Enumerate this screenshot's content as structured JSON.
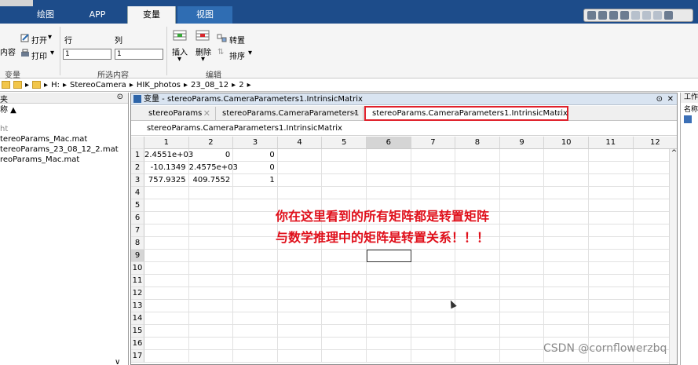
{
  "top_tabs": [
    {
      "label": "绘图"
    },
    {
      "label": "APP"
    },
    {
      "label": "变量"
    },
    {
      "label": "视图"
    }
  ],
  "ribbon": {
    "content_label": "内容",
    "open_label": "打开",
    "print_label": "打印",
    "row_label": "行",
    "col_label": "列",
    "row_value": "1",
    "col_value": "1",
    "insert_label": "插入",
    "delete_label": "删除",
    "transpose_label": "转置",
    "sort_label": "排序",
    "group_variable": "变量",
    "group_selection": "所选内容",
    "group_edit": "编辑"
  },
  "path": [
    "H:",
    "StereoCamera",
    "HIK_photos",
    "23_08_12",
    "2"
  ],
  "file_panel": {
    "header": "夹",
    "name_col": "称 ▲",
    "rows": [
      "ht",
      "tereoParams_Mac.mat",
      "tereoParams_23_08_12_2.mat",
      "reoParams_Mac.mat"
    ]
  },
  "editor": {
    "title": "变量 - stereoParams.CameraParameters1.IntrinsicMatrix",
    "tabs": [
      {
        "label": "stereoParams"
      },
      {
        "label": "stereoParams.CameraParameters1"
      },
      {
        "label": "stereoParams.CameraParameters1.IntrinsicMatrix"
      }
    ],
    "expression": "stereoParams.CameraParameters1.IntrinsicMatrix",
    "columns": [
      "1",
      "2",
      "3",
      "4",
      "5",
      "6",
      "7",
      "8",
      "9",
      "10",
      "11",
      "12"
    ],
    "rows": [
      "1",
      "2",
      "3",
      "4",
      "5",
      "6",
      "7",
      "8",
      "9",
      "10",
      "11",
      "12",
      "13",
      "14",
      "15",
      "16",
      "17"
    ],
    "cells": [
      [
        "2.4551e+03",
        "0",
        "0"
      ],
      [
        "-10.1349",
        "2.4575e+03",
        "0"
      ],
      [
        "757.9325",
        "409.7552",
        "1"
      ]
    ],
    "annotation_line1": "你在这里看到的所有矩阵都是转置矩阵",
    "annotation_line2": "与数学推理中的矩阵是转置关系！！！"
  },
  "right_panel": {
    "header": "工作",
    "name_col": "名称"
  },
  "watermark": "CSDN @cornflowerzbq",
  "colors": {
    "topbar": "#1d4c8a",
    "accent_red": "#e0212b",
    "annotation": "#e0101b"
  }
}
